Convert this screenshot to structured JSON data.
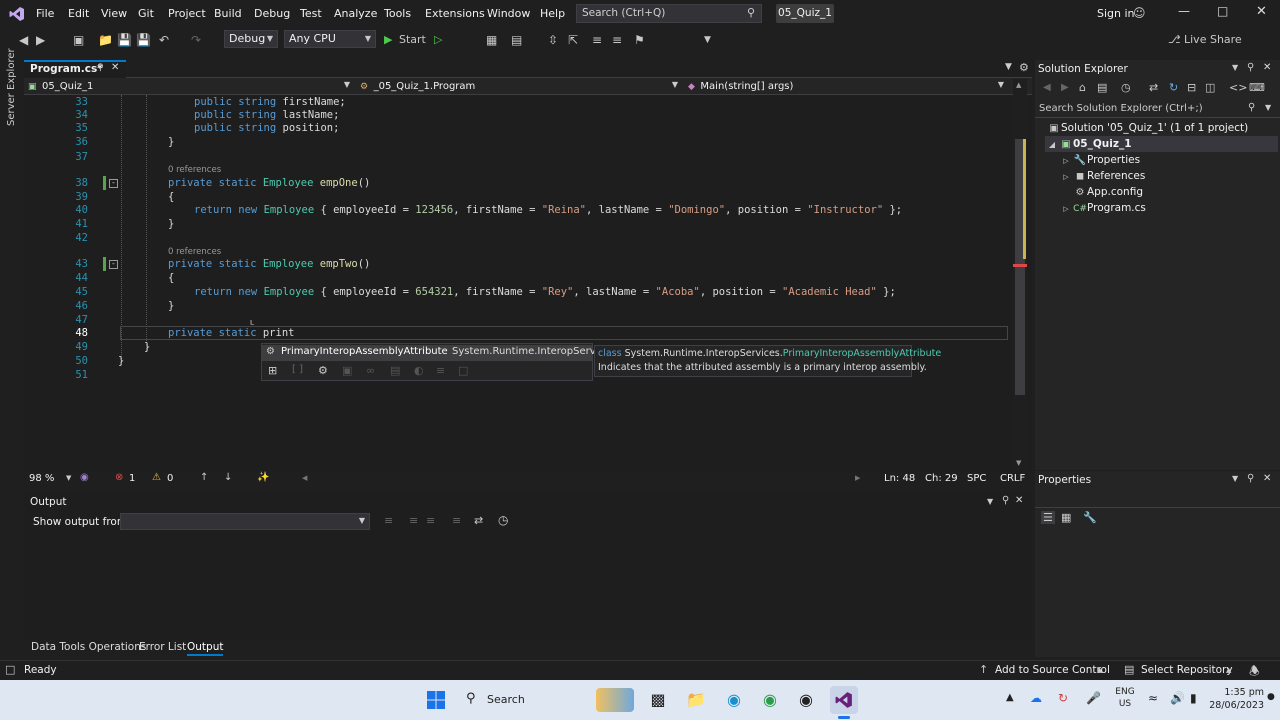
{
  "menu": [
    "File",
    "Edit",
    "View",
    "Git",
    "Project",
    "Build",
    "Debug",
    "Test",
    "Analyze",
    "Tools",
    "Extensions",
    "Window",
    "Help"
  ],
  "search": {
    "placeholder": "Search (Ctrl+Q)"
  },
  "solution_badge": "05_Quiz_1",
  "sign_in": "Sign in",
  "toolbar": {
    "config": "Debug",
    "platform": "Any CPU",
    "start": "Start",
    "live_share": "Live Share"
  },
  "side_tab": "Server Explorer",
  "editor": {
    "tab": "Program.cs*",
    "nav_project": "05_Quiz_1",
    "nav_class": "_05_Quiz_1.Program",
    "nav_member": "Main(string[] args)",
    "refs_label": "0 references",
    "lines": [
      {
        "n": "33",
        "code": "public string firstName;"
      },
      {
        "n": "34",
        "code": "public string lastName;"
      },
      {
        "n": "35",
        "code": "public string position;"
      },
      {
        "n": "36",
        "code": "}"
      },
      {
        "n": "37",
        "code": ""
      },
      {
        "n": "38",
        "code": "private static Employee empOne()"
      },
      {
        "n": "39",
        "code": "{"
      },
      {
        "n": "40",
        "code": "return new Employee { employeeId = 123456, firstName = \"Reina\", lastName = \"Domingo\", position = \"Instructor\" };"
      },
      {
        "n": "41",
        "code": "}"
      },
      {
        "n": "42",
        "code": ""
      },
      {
        "n": "43",
        "code": "private static Employee empTwo()"
      },
      {
        "n": "44",
        "code": "{"
      },
      {
        "n": "45",
        "code": "return new Employee { employeeId = 654321, firstName = \"Rey\", lastName = \"Acoba\", position = \"Academic Head\" };"
      },
      {
        "n": "46",
        "code": "}"
      },
      {
        "n": "47",
        "code": ""
      },
      {
        "n": "48",
        "code": "private static print"
      },
      {
        "n": "49",
        "code": "}"
      },
      {
        "n": "50",
        "code": "}"
      },
      {
        "n": "51",
        "code": ""
      }
    ],
    "intellisense": {
      "item": "PrimaryInteropAssemblyAttribute",
      "namespace": "System.Runtime.InteropServices",
      "tip_kind": "class",
      "tip_ns": "System.Runtime.InteropServices.",
      "tip_type": "PrimaryInteropAssemblyAttribute",
      "tip_desc": "Indicates that the attributed assembly is a primary interop assembly."
    },
    "status": {
      "zoom": "98 %",
      "errors": "1",
      "warnings": "0",
      "ln": "Ln: 48",
      "ch": "Ch: 29",
      "spc": "SPC",
      "crlf": "CRLF"
    }
  },
  "solution_explorer": {
    "title": "Solution Explorer",
    "search_placeholder": "Search Solution Explorer (Ctrl+;)",
    "items": [
      {
        "label": "Solution '05_Quiz_1' (1 of 1 project)",
        "icon": "solution-icon"
      },
      {
        "label": "05_Quiz_1",
        "icon": "csharp-project-icon"
      },
      {
        "label": "Properties",
        "icon": "wrench-icon"
      },
      {
        "label": "References",
        "icon": "references-icon"
      },
      {
        "label": "App.config",
        "icon": "config-icon"
      },
      {
        "label": "Program.cs",
        "icon": "csharp-file-icon"
      }
    ]
  },
  "properties": {
    "title": "Properties"
  },
  "output": {
    "title": "Output",
    "show_from": "Show output from:"
  },
  "bottom_tabs": [
    "Data Tools Operations",
    "Error List",
    "Output"
  ],
  "statusbar": {
    "ready": "Ready",
    "source_control": "Add to Source Control",
    "repo": "Select Repository"
  },
  "taskbar": {
    "search": "Search",
    "lang1": "ENG",
    "lang2": "US",
    "time": "1:35 pm",
    "date": "28/06/2023"
  },
  "colors": {
    "accent": "#007acc",
    "vs_purple": "#68217a",
    "keyword": "#569cd6",
    "type": "#4ec9b0"
  }
}
